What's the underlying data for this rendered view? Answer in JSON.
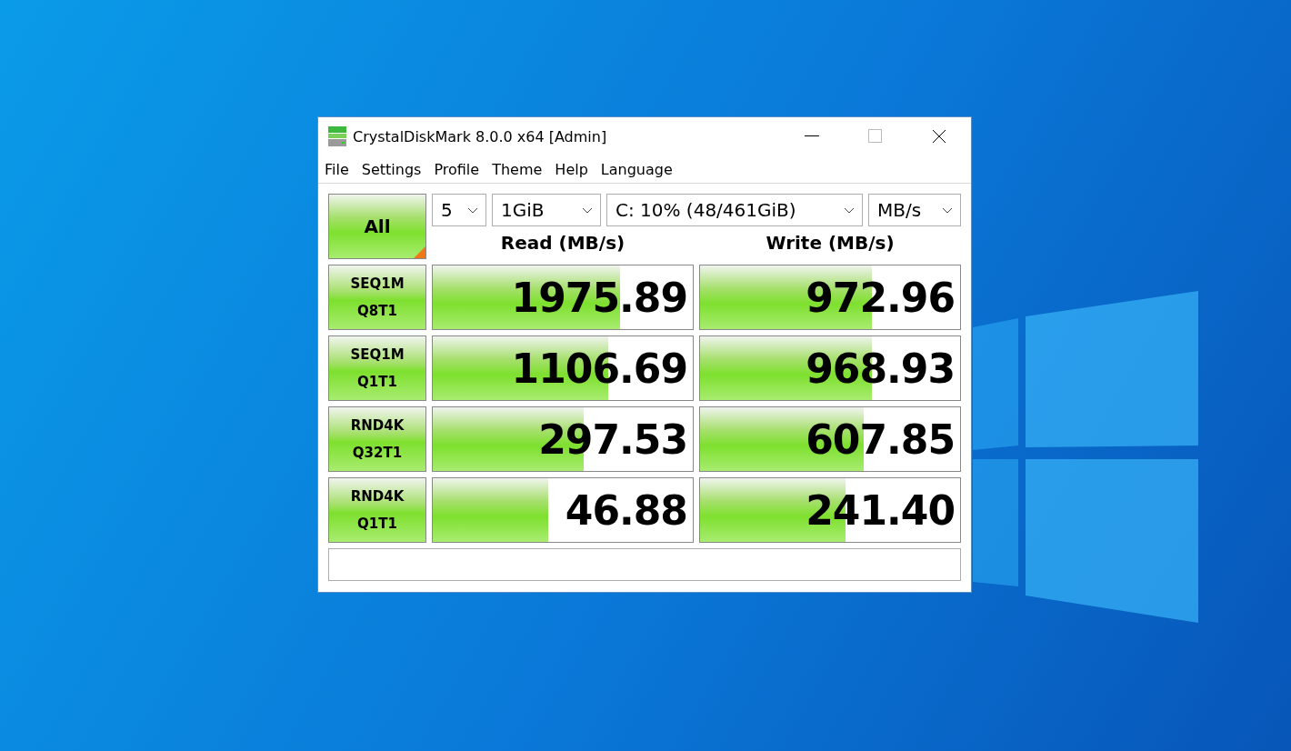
{
  "window": {
    "title": "CrystalDiskMark 8.0.0 x64 [Admin]"
  },
  "menu": [
    "File",
    "Settings",
    "Profile",
    "Theme",
    "Help",
    "Language"
  ],
  "all_button": {
    "label": "All"
  },
  "selectors": [
    {
      "value": "5"
    },
    {
      "value": "1GiB"
    },
    {
      "value": "C: 10% (48/461GiB)"
    },
    {
      "value": "MB/s"
    }
  ],
  "columns": [
    "Read (MB/s)",
    "Write (MB/s)"
  ],
  "tests": [
    {
      "line1": "SEQ1M",
      "line2": "Q8T1",
      "read": {
        "value": "1975.89",
        "level": 0.72
      },
      "write": {
        "value": "972.96",
        "level": 0.66
      }
    },
    {
      "line1": "SEQ1M",
      "line2": "Q1T1",
      "read": {
        "value": "1106.69",
        "level": 0.675
      },
      "write": {
        "value": "968.93",
        "level": 0.66
      }
    },
    {
      "line1": "RND4K",
      "line2": "Q32T1",
      "read": {
        "value": "297.53",
        "level": 0.58
      },
      "write": {
        "value": "607.85",
        "level": 0.63
      }
    },
    {
      "line1": "RND4K",
      "line2": "Q1T1",
      "read": {
        "value": "46.88",
        "level": 0.445
      },
      "write": {
        "value": "241.40",
        "level": 0.56
      }
    }
  ]
}
